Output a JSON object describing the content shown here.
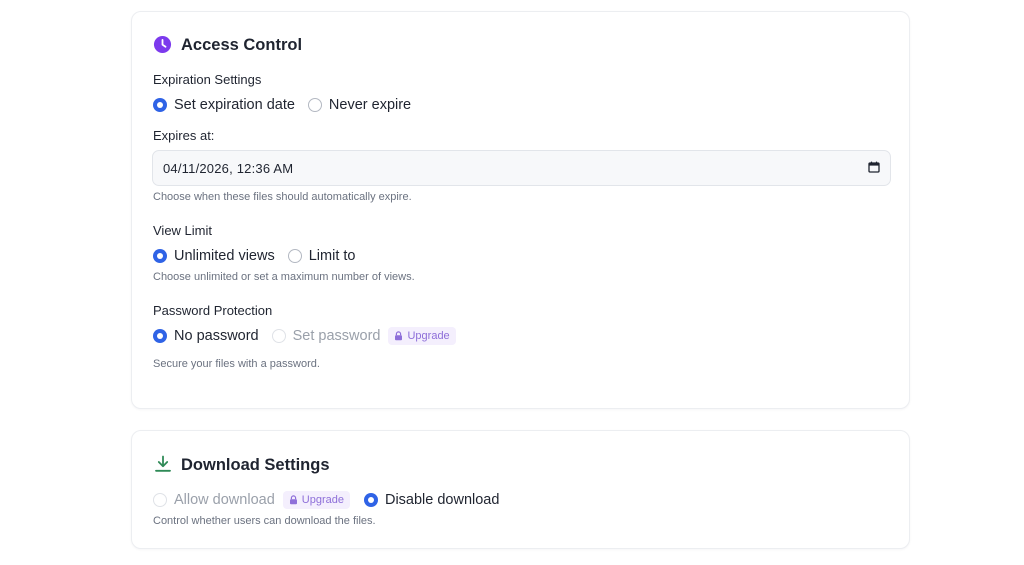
{
  "access_control": {
    "title": "Access Control",
    "icon": "clock-icon",
    "accent": "#7c3aed",
    "expiration": {
      "label": "Expiration Settings",
      "options": [
        {
          "label": "Set expiration date",
          "checked": true
        },
        {
          "label": "Never expire",
          "checked": false
        }
      ],
      "expires_label": "Expires at:",
      "expires_value": "04/11/2026, 12:36 AM",
      "help": "Choose when these files should automatically expire."
    },
    "view_limit": {
      "label": "View Limit",
      "options": [
        {
          "label": "Unlimited views",
          "checked": true
        },
        {
          "label": "Limit to",
          "checked": false
        }
      ],
      "help": "Choose unlimited or set a maximum number of views."
    },
    "password": {
      "label": "Password Protection",
      "options": [
        {
          "label": "No password",
          "checked": true
        },
        {
          "label": "Set password",
          "checked": false,
          "disabled": true
        }
      ],
      "badge": "Upgrade",
      "help": "Secure your files with a password."
    }
  },
  "download_settings": {
    "title": "Download Settings",
    "icon": "download-icon",
    "accent": "#2f8a57",
    "options": [
      {
        "label": "Allow download",
        "checked": false,
        "disabled": true
      },
      {
        "label": "Disable download",
        "checked": true
      }
    ],
    "badge": "Upgrade",
    "help": "Control whether users can download the files."
  },
  "colors": {
    "radio_checked": "#2f63e6",
    "badge_bg": "#f4effd",
    "badge_text": "#8e6fd9"
  }
}
